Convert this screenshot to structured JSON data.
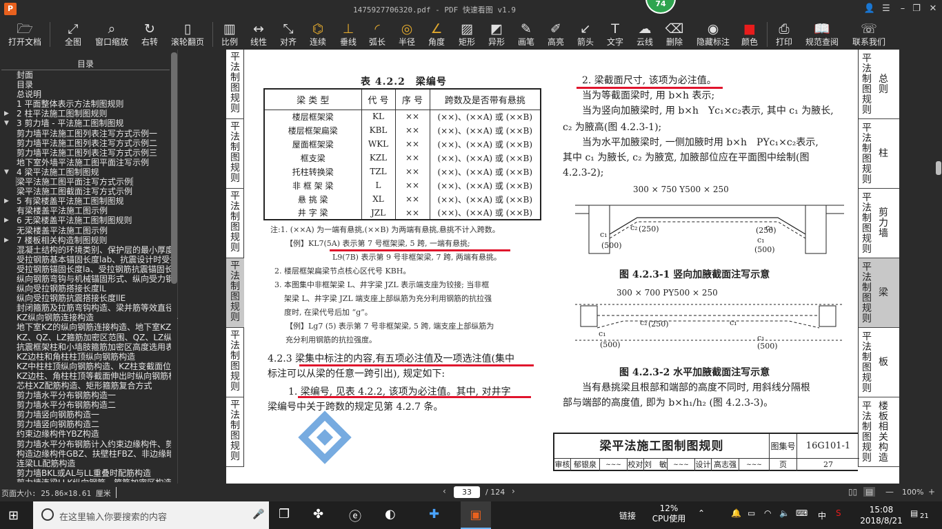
{
  "titlebar": {
    "title": "1475927706320.pdf - PDF 快速看图 v1.9",
    "badge": "74",
    "logo": "P"
  },
  "toolbar": {
    "items": [
      {
        "label": "打开文档",
        "icon": "folder-icon"
      },
      {
        "label": "全图",
        "icon": "fullscreen-icon"
      },
      {
        "label": "窗口缩放",
        "icon": "zoom-window-icon"
      },
      {
        "label": "右转",
        "icon": "rotate-right-icon"
      },
      {
        "label": "滚轮翻页",
        "icon": "mouse-wheel-icon"
      },
      {
        "label": "比例",
        "icon": "scale-icon"
      },
      {
        "label": "线性",
        "icon": "linear-dimension-icon"
      },
      {
        "label": "对齐",
        "icon": "aligned-dimension-icon"
      },
      {
        "label": "连续",
        "icon": "continuous-dimension-icon"
      },
      {
        "label": "垂线",
        "icon": "perpendicular-icon"
      },
      {
        "label": "弧长",
        "icon": "arc-length-icon"
      },
      {
        "label": "半径",
        "icon": "radius-icon"
      },
      {
        "label": "角度",
        "icon": "angle-icon"
      },
      {
        "label": "矩形",
        "icon": "rectangle-area-icon"
      },
      {
        "label": "异形",
        "icon": "polygon-area-icon"
      },
      {
        "label": "画笔",
        "icon": "pen-icon"
      },
      {
        "label": "高亮",
        "icon": "highlight-icon"
      },
      {
        "label": "箭头",
        "icon": "arrow-icon"
      },
      {
        "label": "文字",
        "icon": "text-icon"
      },
      {
        "label": "云线",
        "icon": "cloud-line-icon"
      },
      {
        "label": "删除",
        "icon": "eraser-icon"
      },
      {
        "label": "隐藏标注",
        "icon": "hide-annotation-icon"
      },
      {
        "label": "颜色",
        "icon": "color-swatch-icon"
      },
      {
        "label": "打印",
        "icon": "printer-icon"
      },
      {
        "label": "规范查阅",
        "icon": "standards-book-icon"
      },
      {
        "label": "联系我们",
        "icon": "contact-icon"
      }
    ],
    "accent": "#e0a82e",
    "color_swatch": "#e81c1c"
  },
  "toc": {
    "header": "目录",
    "items": [
      {
        "label": "封面",
        "arrow": ""
      },
      {
        "label": "目录",
        "arrow": ""
      },
      {
        "label": "总说明",
        "arrow": ""
      },
      {
        "label": "1 平面整体表示方法制图规则",
        "arrow": ""
      },
      {
        "label": "2 柱平法施工图制图规则",
        "arrow": "▶"
      },
      {
        "label": "3 剪力墙 - 平法施工图制图规",
        "arrow": "▼"
      },
      {
        "label": "剪力墙平法施工图列表注写方式示例一",
        "arrow": ""
      },
      {
        "label": "剪力墙平法施工图列表注写方式示例二",
        "arrow": ""
      },
      {
        "label": "剪力墙平法施工图列表注写方式示例三",
        "arrow": ""
      },
      {
        "label": "地下室外墙平法施工图平面注写示例",
        "arrow": ""
      },
      {
        "label": "4 梁平法施工图制图规",
        "arrow": "▼"
      },
      {
        "label": "梁平法施工图平面注写方式示例",
        "arrow": "",
        "selected": true
      },
      {
        "label": "梁平法施工图截面注写方式示例",
        "arrow": ""
      },
      {
        "label": "5 有梁楼盖平法施工图制图规",
        "arrow": "▶"
      },
      {
        "label": "有梁楼盖平法施工图示例",
        "arrow": ""
      },
      {
        "label": "6 无梁楼盖平法施工图制图规则",
        "arrow": "▶"
      },
      {
        "label": "无梁楼盖平法施工图示例",
        "arrow": ""
      },
      {
        "label": "7 楼板相关构造制图规则",
        "arrow": "▶"
      },
      {
        "label": "混凝土结构的环境类别、保护层的最小厚度",
        "arrow": ""
      },
      {
        "label": "受拉钢筋基本锚固长度lab、抗震设计时受拉",
        "arrow": ""
      },
      {
        "label": "受拉钢筋锚固长度la、受拉钢筋抗震锚固长",
        "arrow": ""
      },
      {
        "label": "纵向钢筋弯钩与机械锚固形式、纵向受力钢",
        "arrow": ""
      },
      {
        "label": "纵向受拉钢筋搭接长度lL",
        "arrow": ""
      },
      {
        "label": "纵向受拉钢筋抗震搭接长度llE",
        "arrow": ""
      },
      {
        "label": "封闭箍筋及拉筋弯钩构造、梁并筋等效直径",
        "arrow": ""
      },
      {
        "label": "KZ纵向钢筋连接构造",
        "arrow": ""
      },
      {
        "label": "地下室KZ的纵向钢筋连接构造、地下室KZ的",
        "arrow": ""
      },
      {
        "label": "KZ、QZ、LZ箍筋加密区范围、QZ、LZ纵向钢",
        "arrow": ""
      },
      {
        "label": "抗震框架柱和小墙肢箍筋加密区高度选用表",
        "arrow": ""
      },
      {
        "label": "KZ边柱和角柱柱顶纵向钢筋构造",
        "arrow": ""
      },
      {
        "label": "KZ中柱柱顶纵向钢筋构造、KZ柱变截面位置",
        "arrow": ""
      },
      {
        "label": "KZ边柱、角柱柱顶等截面伸出时纵向钢筋构",
        "arrow": ""
      },
      {
        "label": "芯柱XZ配筋构造、矩形箍筋复合方式",
        "arrow": ""
      },
      {
        "label": "剪力墙水平分布钢筋构造一",
        "arrow": ""
      },
      {
        "label": "剪力墙水平分布钢筋构造二",
        "arrow": ""
      },
      {
        "label": "剪力墙竖向钢筋构造一",
        "arrow": ""
      },
      {
        "label": "剪力墙竖向钢筋构造二",
        "arrow": ""
      },
      {
        "label": "约束边缘构件YBZ构造",
        "arrow": ""
      },
      {
        "label": "剪力墙水平分布钢筋计入约束边缘构件、剪",
        "arrow": ""
      },
      {
        "label": "构造边缘构件GBZ、扶壁柱FBZ、非边缘暗柱",
        "arrow": ""
      },
      {
        "label": "连梁LL配筋构造",
        "arrow": ""
      },
      {
        "label": "剪力墙BKL或AL与LL重叠时配筋构造",
        "arrow": ""
      },
      {
        "label": "剪力墙连梁LLK纵向钢筋、箍筋加密区构造",
        "arrow": ""
      }
    ]
  },
  "page": {
    "left_tabs": [
      {
        "label": "平法制图规则",
        "active": false
      },
      {
        "label": "平法制图规则",
        "active": false
      },
      {
        "label": "平法制图规则",
        "active": false
      },
      {
        "label": "平法制图规则",
        "active": true
      },
      {
        "label": "平法制图规则",
        "active": false
      },
      {
        "label": "平法制图规则",
        "active": false
      }
    ],
    "right_tabs": [
      {
        "label": "平法制图规则",
        "name": "总则",
        "active": false
      },
      {
        "label": "平法制图规则",
        "name": "柱",
        "active": false
      },
      {
        "label": "平法制图规则",
        "name": "剪力墙",
        "active": false
      },
      {
        "label": "平法制图规则",
        "name": "梁",
        "active": true
      },
      {
        "label": "平法制图规则",
        "name": "板",
        "active": false
      },
      {
        "label": "平法制图规则",
        "name": "楼板相关构造",
        "active": false
      }
    ],
    "table_title": "表 4.2.2　梁编号",
    "table": {
      "headers": [
        "梁 类 型",
        "代 号",
        "序 号",
        "跨数及是否带有悬挑"
      ],
      "rows": [
        [
          "楼层框架梁",
          "KL",
          "××",
          "(××)、(××A) 或 (××B)"
        ],
        [
          "楼层框架扁梁",
          "KBL",
          "××",
          "(××)、(××A) 或 (××B)"
        ],
        [
          "屋面框架梁",
          "WKL",
          "××",
          "(××)、(××A) 或 (××B)"
        ],
        [
          "框支梁",
          "KZL",
          "××",
          "(××)、(××A) 或 (××B)"
        ],
        [
          "托柱转换梁",
          "TZL",
          "××",
          "(××)、(××A) 或 (××B)"
        ],
        [
          "非 框 架 梁",
          "L",
          "××",
          "(××)、(××A) 或 (××B)"
        ],
        [
          "悬 挑 梁",
          "XL",
          "××",
          "(××)、(××A) 或 (××B)"
        ],
        [
          "井 字 梁",
          "JZL",
          "××",
          "(××)、(××A) 或 (××B)"
        ]
      ]
    },
    "notes": [
      "注:1. (××A) 为一端有悬挑,(××B) 为两端有悬挑,悬挑不计入跨数。",
      "【例】KL7(5A) 表示第 7 号框架梁, 5 跨, 一端有悬挑;",
      "L9(7B) 表示第 9 号非框架梁, 7 跨, 两端有悬挑。",
      "2. 楼层框架扁梁节点核心区代号 KBH。",
      "3. 本图集中非框架梁 L、井字梁 JZL 表示端支座为铰接; 当非框",
      "架梁 L、井字梁 JZL 端支座上部纵筋为充分利用钢筋的抗拉强",
      "度时, 在梁代号后加 “g”。",
      "【例】Lg7 (5) 表示第 7 号非框架梁, 5 跨, 端支座上部纵筋为",
      "充分利用钢筋的抗拉强度。"
    ],
    "section_423_a": "4.2.3 梁集中标注的内容,有五项必注值及一项选注值(集中",
    "section_423_b": "标注可以从梁的任意一跨引出), 规定如下:",
    "item1_a": "1. 梁编号, 见表 4.2.2, 该项为必注值。其中, 对井字",
    "item1_b": "梁编号中关于跨数的规定见第 4.2.7 条。",
    "right_text": [
      "2. 梁截面尺寸, 该项为必注值。",
      "当为等截面梁时, 用 b×h 表示;",
      "当为竖向加腋梁时, 用 b×h　Yc₁×c₂表示, 其中 c₁ 为腋长,",
      "c₂ 为腋高(图 4.2.3-1);",
      "当为水平加腋梁时, 一侧加腋时用 b×h　PYc₁×c₂表示,",
      "其中 c₁ 为腋长, c₂ 为腋宽, 加腋部位应在平面图中绘制(图",
      "4.2.3-2);"
    ],
    "fig1_dim": "300 × 750 Y500 × 250",
    "fig1_caption": "图 4.2.3-1 竖向加腋截面注写示意",
    "fig2_dim": "300 × 700 PY500 × 250",
    "fig2_caption": "图 4.2.3-2 水平加腋截面注写示意",
    "after_fig": [
      "当有悬挑梁且根部和端部的高度不同时, 用斜线分隔根",
      "部与端部的高度值, 即为 b×h₁/h₂ (图 4.2.3-3)。"
    ],
    "fig_labels": {
      "c1": "c₁",
      "c2": "c₂",
      "v500": "(500)",
      "v250": "(250)"
    },
    "titleblock": {
      "title": "梁平法施工图制图规则",
      "code_label": "图集号",
      "code": "16G101-1",
      "row": [
        "审核",
        "郁银泉",
        "校对",
        "刘　敏",
        "设计",
        "高志强",
        "页",
        "27"
      ],
      "signatures": [
        "郁银泉 signature",
        "刘敏 signature",
        "高志强 signature"
      ]
    },
    "annotation_color": "#e0132c"
  },
  "statusbar": {
    "page_size": "页面大小: 25.86×18.61 厘米",
    "current_page": "33",
    "total_pages": "/ 124",
    "zoom": "100%"
  },
  "taskbar": {
    "search_placeholder": "在这里输入你要搜索的内容",
    "cpu_percent": "12%",
    "cpu_label": "CPU使用",
    "tray_link": "链接",
    "ime": "中",
    "time": "15:08",
    "date": "2018/8/21",
    "notification_count": "21"
  }
}
